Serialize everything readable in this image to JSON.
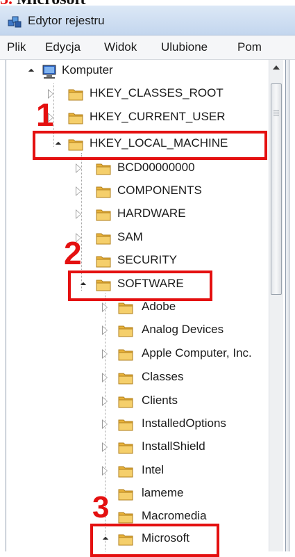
{
  "caption": {
    "number": "3.",
    "text": "Microsoft"
  },
  "window": {
    "title": "Edytor rejestru"
  },
  "menu": [
    "Plik",
    "Edycja",
    "Widok",
    "Ulubione",
    "Pom"
  ],
  "tree": {
    "root": "Komputer",
    "hives": [
      "HKEY_CLASSES_ROOT",
      "HKEY_CURRENT_USER",
      "HKEY_LOCAL_MACHINE"
    ],
    "hklm_children": [
      "BCD00000000",
      "COMPONENTS",
      "HARDWARE",
      "SAM",
      "SECURITY",
      "SOFTWARE"
    ],
    "software_children": [
      "Adobe",
      "Analog Devices",
      "Apple Computer, Inc.",
      "Classes",
      "Clients",
      "InstalledOptions",
      "InstallShield",
      "Intel",
      "lameme",
      "Macromedia",
      "Microsoft"
    ]
  },
  "annotations": {
    "steps": [
      "1",
      "2",
      "3"
    ]
  },
  "colors": {
    "annotation": "#e41010",
    "folder": "#e8b23a"
  }
}
